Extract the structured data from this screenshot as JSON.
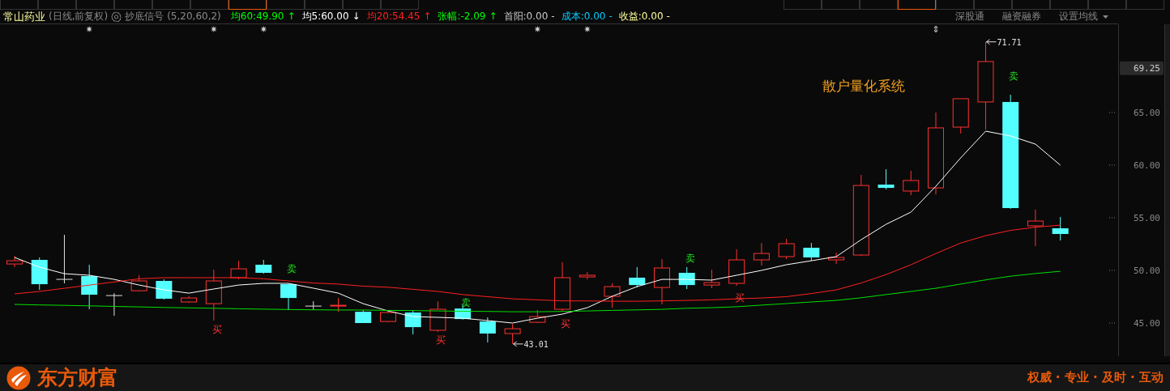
{
  "top_strip": [
    {
      "selected": false
    },
    {
      "selected": false
    },
    {
      "selected": false
    },
    {
      "selected": false
    },
    {
      "selected": false
    },
    {
      "selected": false
    },
    {
      "selected": true
    },
    {
      "selected": false
    },
    {
      "selected": false
    },
    {
      "selected": false
    },
    {
      "selected": false
    }
  ],
  "top_strip_right": [
    {
      "selected": false
    },
    {
      "selected": false
    },
    {
      "selected": false
    },
    {
      "selected": true
    },
    {
      "selected": false
    },
    {
      "selected": false
    },
    {
      "selected": false
    },
    {
      "selected": false
    },
    {
      "selected": false
    },
    {
      "selected": false
    }
  ],
  "header": {
    "stock_name": "常山药业",
    "period": "(日线,前复权)",
    "indicator_name": "抄底信号",
    "params": "(5,20,60,2)",
    "stats": [
      {
        "label": "均60",
        "value": ":49.90",
        "trend": "↑",
        "color": "#00ff00"
      },
      {
        "label": "均5",
        "value": ":60.00",
        "trend": "↓",
        "color": "#ffffff"
      },
      {
        "label": "均20",
        "value": ":54.45",
        "trend": "↑",
        "color": "#ff2020"
      },
      {
        "label": "张幅",
        "value": ":-2.09",
        "trend": "↑",
        "color": "#00ff00"
      },
      {
        "label": "首阳",
        "value": ":0.00",
        "trend": "-",
        "color": "#c8c8c8"
      },
      {
        "label": "成本",
        "value": ":0.00",
        "trend": "-",
        "color": "#00ccff"
      },
      {
        "label": "收益",
        "value": ":0.00",
        "trend": "-",
        "color": "#ffff99"
      }
    ],
    "links": [
      "深股通",
      "融资融券",
      "设置均线"
    ]
  },
  "chart": {
    "overlay_text": "散户量化系统",
    "price_tag": "69.25",
    "axis_labels": [
      "65.00",
      "60.00",
      "55.00",
      "50.00",
      "45.00"
    ],
    "high_label": "71.71",
    "low_label": "43.01",
    "top_marks": [
      "✷",
      "✷",
      "✷",
      "✷",
      "✷",
      "⇕"
    ],
    "signals": [
      {
        "kind": "buy",
        "text": "买"
      },
      {
        "kind": "buy",
        "text": "买"
      },
      {
        "kind": "buy",
        "text": "买"
      },
      {
        "kind": "buy",
        "text": "买"
      },
      {
        "kind": "sell",
        "text": "卖"
      },
      {
        "kind": "sell",
        "text": "卖"
      },
      {
        "kind": "sell",
        "text": "卖"
      },
      {
        "kind": "sell",
        "text": "卖"
      }
    ]
  },
  "footer": {
    "brand": "东方财富",
    "slogan": "权威 · 专业 · 及时 · 互动"
  }
}
